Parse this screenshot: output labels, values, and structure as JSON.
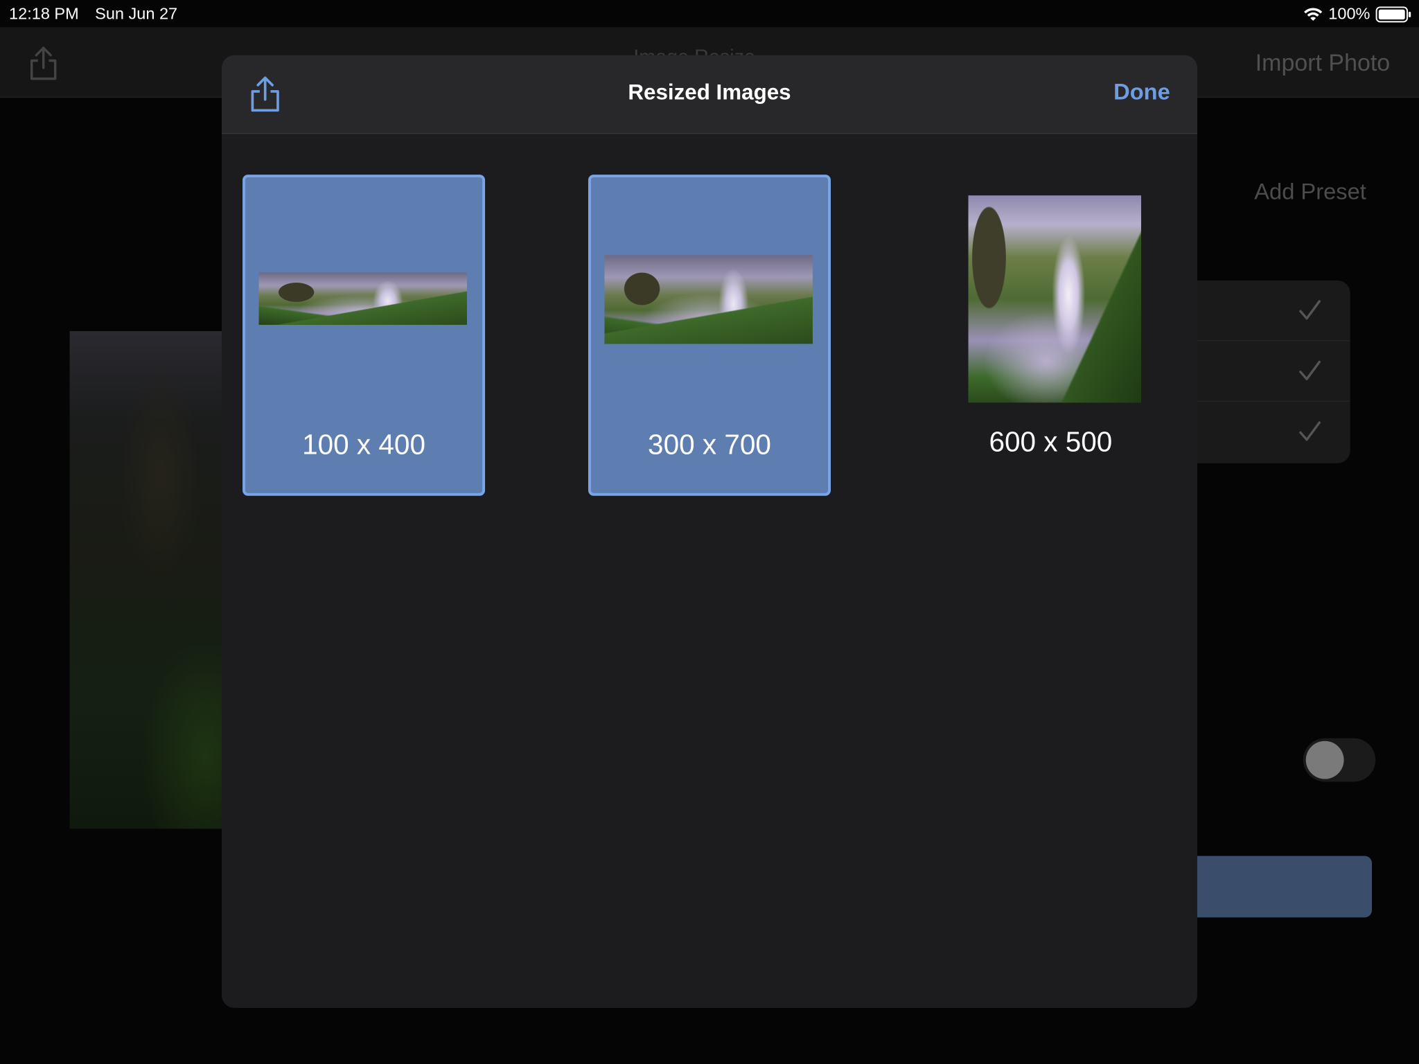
{
  "status_bar": {
    "time": "12:18 PM",
    "date": "Sun Jun 27",
    "battery": "100%",
    "wifi_icon": "wifi-icon",
    "battery_icon": "battery-icon"
  },
  "background_app": {
    "title": "Image Resize",
    "import_label": "Import Photo",
    "add_preset_label": "Add Preset",
    "preset_checks": 3,
    "toggle_on": false
  },
  "sheet": {
    "title": "Resized Images",
    "done_label": "Done",
    "share_icon": "share-icon",
    "accent_color": "#6e9de0",
    "selected_color": "#5e7db0",
    "images": [
      {
        "label": "100 x 400",
        "selected": true
      },
      {
        "label": "300 x 700",
        "selected": true
      },
      {
        "label": "600 x 500",
        "selected": false
      }
    ]
  }
}
